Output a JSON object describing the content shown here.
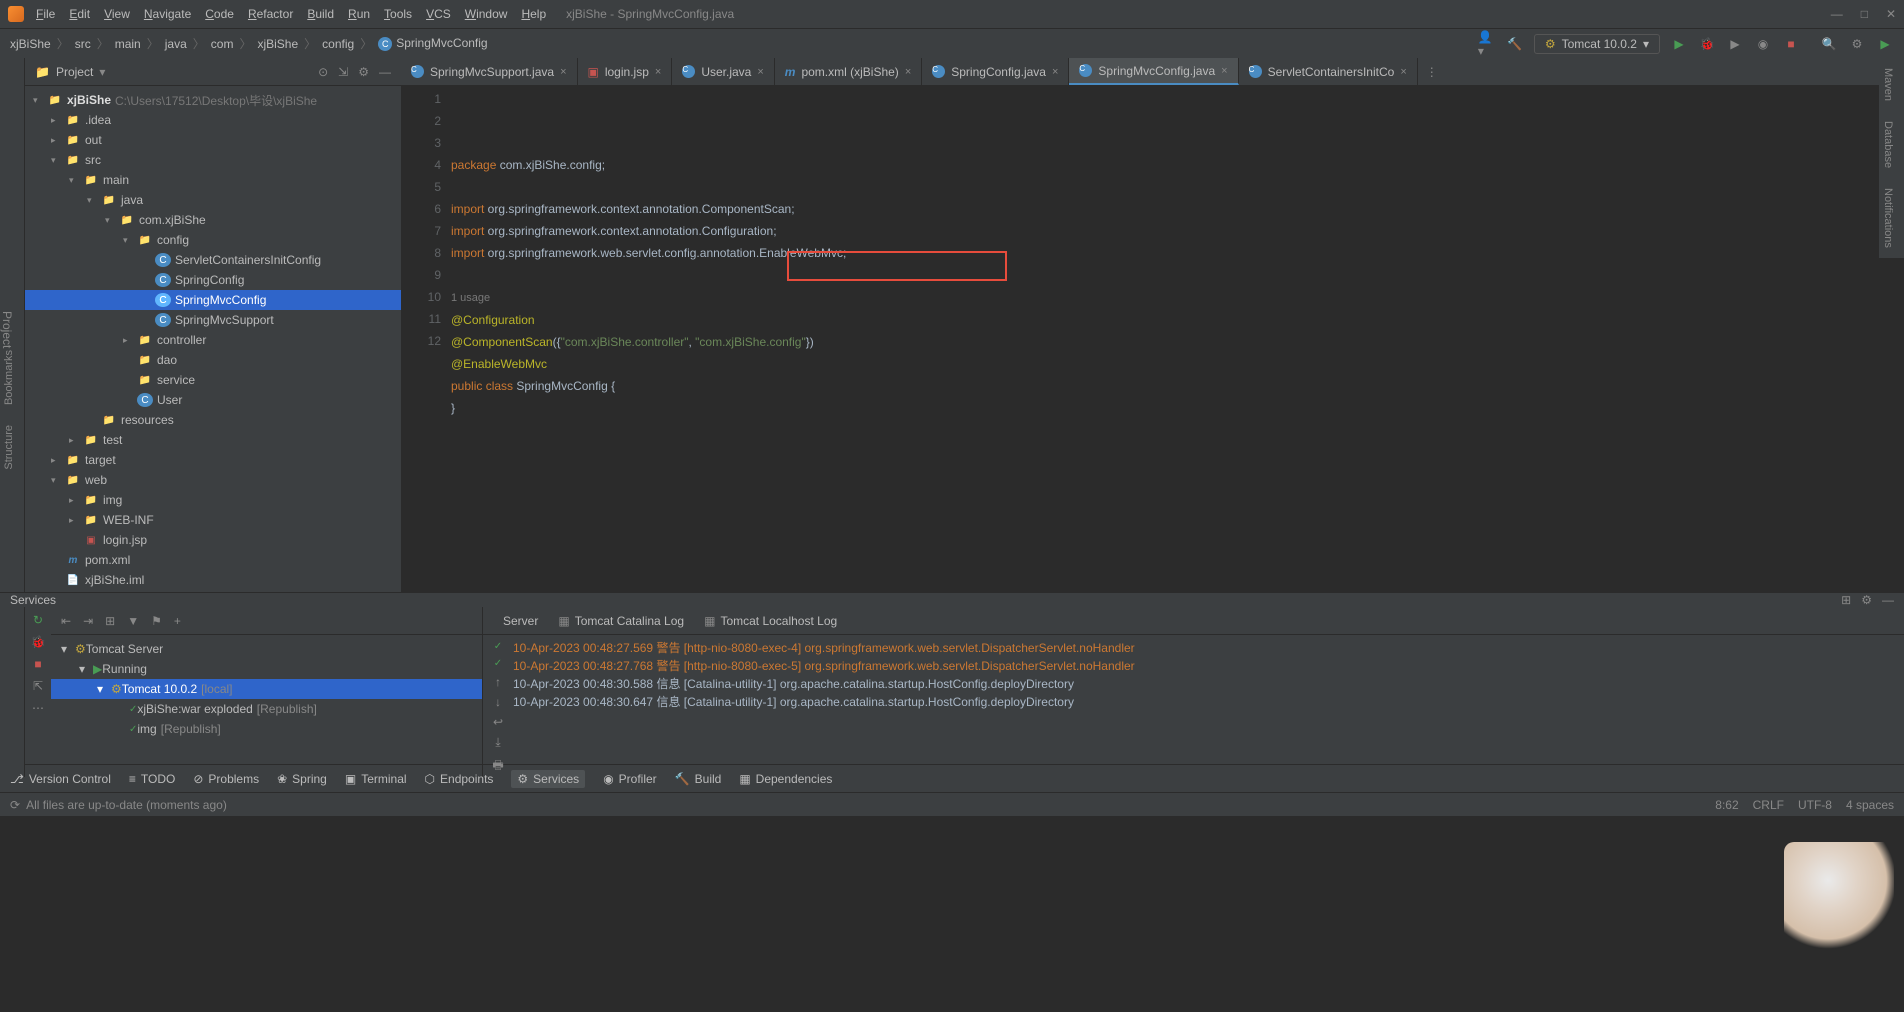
{
  "window": {
    "title": "xjBiShe - SpringMvcConfig.java"
  },
  "menu": [
    "File",
    "Edit",
    "View",
    "Navigate",
    "Code",
    "Refactor",
    "Build",
    "Run",
    "Tools",
    "VCS",
    "Window",
    "Help"
  ],
  "breadcrumb": [
    "xjBiShe",
    "src",
    "main",
    "java",
    "com",
    "xjBiShe",
    "config",
    "SpringMvcConfig"
  ],
  "runConfig": {
    "label": "Tomcat 10.0.2"
  },
  "projectPanel": {
    "title": "Project"
  },
  "tree": {
    "root": {
      "name": "xjBiShe",
      "path": "C:\\Users\\17512\\Desktop\\毕设\\xjBiShe"
    },
    "items": [
      {
        "depth": 1,
        "chev": ">",
        "icon": "folder",
        "name": ".idea"
      },
      {
        "depth": 1,
        "chev": ">",
        "icon": "folder-orange",
        "name": "out"
      },
      {
        "depth": 1,
        "chev": "v",
        "icon": "folder",
        "name": "src"
      },
      {
        "depth": 2,
        "chev": "v",
        "icon": "folder",
        "name": "main"
      },
      {
        "depth": 3,
        "chev": "v",
        "icon": "folder",
        "name": "java"
      },
      {
        "depth": 4,
        "chev": "v",
        "icon": "folder",
        "name": "com.xjBiShe"
      },
      {
        "depth": 5,
        "chev": "v",
        "icon": "folder",
        "name": "config"
      },
      {
        "depth": 6,
        "chev": "",
        "icon": "class",
        "name": "ServletContainersInitConfig"
      },
      {
        "depth": 6,
        "chev": "",
        "icon": "class",
        "name": "SpringConfig"
      },
      {
        "depth": 6,
        "chev": "",
        "icon": "class",
        "name": "SpringMvcConfig",
        "selected": true
      },
      {
        "depth": 6,
        "chev": "",
        "icon": "class",
        "name": "SpringMvcSupport"
      },
      {
        "depth": 5,
        "chev": ">",
        "icon": "folder",
        "name": "controller"
      },
      {
        "depth": 5,
        "chev": "",
        "icon": "folder",
        "name": "dao"
      },
      {
        "depth": 5,
        "chev": "",
        "icon": "folder",
        "name": "service"
      },
      {
        "depth": 5,
        "chev": "",
        "icon": "class",
        "name": "User"
      },
      {
        "depth": 3,
        "chev": "",
        "icon": "folder",
        "name": "resources"
      },
      {
        "depth": 2,
        "chev": ">",
        "icon": "folder",
        "name": "test"
      },
      {
        "depth": 1,
        "chev": ">",
        "icon": "folder-orange",
        "name": "target"
      },
      {
        "depth": 1,
        "chev": "v",
        "icon": "folder",
        "name": "web"
      },
      {
        "depth": 2,
        "chev": ">",
        "icon": "folder",
        "name": "img"
      },
      {
        "depth": 2,
        "chev": ">",
        "icon": "folder",
        "name": "WEB-INF"
      },
      {
        "depth": 2,
        "chev": "",
        "icon": "jsp",
        "name": "login.jsp"
      },
      {
        "depth": 1,
        "chev": "",
        "icon": "maven",
        "name": "pom.xml"
      },
      {
        "depth": 1,
        "chev": "",
        "icon": "file",
        "name": "xjBiShe.iml"
      }
    ]
  },
  "tabs": [
    {
      "icon": "class",
      "label": "SpringMvcSupport.java"
    },
    {
      "icon": "jsp",
      "label": "login.jsp"
    },
    {
      "icon": "class",
      "label": "User.java"
    },
    {
      "icon": "maven",
      "label": "pom.xml (xjBiShe)"
    },
    {
      "icon": "class",
      "label": "SpringConfig.java"
    },
    {
      "icon": "class",
      "label": "SpringMvcConfig.java",
      "active": true
    },
    {
      "icon": "class",
      "label": "ServletContainersInitCo"
    }
  ],
  "code": {
    "lines": [
      {
        "n": 1,
        "html": "<span class='kw'>package</span> com.xjBiShe.<span class='pkg'>config</span>;"
      },
      {
        "n": 2,
        "html": ""
      },
      {
        "n": 3,
        "html": "<span class='kw'>import</span> org.springframework.context.annotation.<span class='pkg'>ComponentScan</span>;"
      },
      {
        "n": 4,
        "html": "<span class='kw'>import</span> org.springframework.context.annotation.<span class='pkg'>Configuration</span>;"
      },
      {
        "n": 5,
        "html": "<span class='kw'>import</span> org.springframework.web.servlet.config.annotation.<span class='pkg'>EnableWebMvc</span>;"
      },
      {
        "n": 6,
        "html": ""
      },
      {
        "n": "",
        "html": "<span class='usage'>1 usage</span>"
      },
      {
        "n": 7,
        "html": "<span class='anno'>@Configuration</span>"
      },
      {
        "n": 8,
        "html": "<span class='anno'>@ComponentScan</span>({<span class='str'>\"com.xjBiShe.controller\"</span>, <span class='str'>\"com.xjBiShe.config\"</span>})"
      },
      {
        "n": 9,
        "html": "<span class='anno'>@EnableWebMvc</span>"
      },
      {
        "n": 10,
        "html": "<span class='kw'>public</span> <span class='kw'>class</span> SpringMvcConfig {"
      },
      {
        "n": 11,
        "html": "}"
      },
      {
        "n": 12,
        "html": ""
      }
    ]
  },
  "services": {
    "title": "Services",
    "tree": [
      {
        "depth": 0,
        "chev": "v",
        "icon": "tomcat",
        "name": "Tomcat Server"
      },
      {
        "depth": 1,
        "chev": "v",
        "icon": "run",
        "name": "Running"
      },
      {
        "depth": 2,
        "chev": "v",
        "icon": "tomcat",
        "name": "Tomcat 10.0.2",
        "suffix": "[local]",
        "sel": true
      },
      {
        "depth": 3,
        "chev": "",
        "icon": "check",
        "name": "xjBiShe:war exploded",
        "suffix": "[Republish]"
      },
      {
        "depth": 3,
        "chev": "",
        "icon": "check",
        "name": "img",
        "suffix": "[Republish]"
      }
    ],
    "consoleTabs": [
      "Server",
      "Tomcat Catalina Log",
      "Tomcat Localhost Log"
    ],
    "logs": [
      {
        "cls": "log-warn",
        "text": "10-Apr-2023 00:48:27.569 警告 [http-nio-8080-exec-4] org.springframework.web.servlet.DispatcherServlet.noHandler"
      },
      {
        "cls": "log-warn",
        "text": "10-Apr-2023 00:48:27.768 警告 [http-nio-8080-exec-5] org.springframework.web.servlet.DispatcherServlet.noHandler"
      },
      {
        "cls": "log-info",
        "text": "10-Apr-2023 00:48:30.588 信息 [Catalina-utility-1] org.apache.catalina.startup.HostConfig.deployDirectory"
      },
      {
        "cls": "log-info",
        "text": "10-Apr-2023 00:48:30.647 信息 [Catalina-utility-1] org.apache.catalina.startup.HostConfig.deployDirectory"
      }
    ]
  },
  "bottomBar": [
    "Version Control",
    "TODO",
    "Problems",
    "Spring",
    "Terminal",
    "Endpoints",
    "Services",
    "Profiler",
    "Build",
    "Dependencies"
  ],
  "statusBar": {
    "left": "All files are up-to-date (moments ago)",
    "right": [
      "8:62",
      "CRLF",
      "UTF-8",
      "4 spaces"
    ]
  },
  "rightTabs": [
    "Maven",
    "Database",
    "Notifications"
  ],
  "leftTabs": [
    "Bookmarks",
    "Structure"
  ],
  "leftGutterTab": "Project"
}
